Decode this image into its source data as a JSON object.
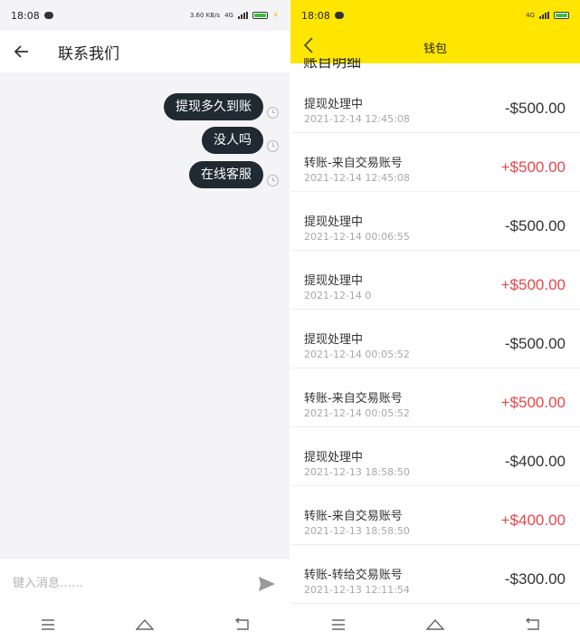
{
  "left": {
    "status": {
      "time": "18:08",
      "network": "3.60 KB/s",
      "signal": "4G"
    },
    "header": {
      "title": "联系我们"
    },
    "messages": [
      {
        "text": "提现多久到账"
      },
      {
        "text": "没人吗"
      },
      {
        "text": "在线客服"
      }
    ],
    "input": {
      "placeholder": "键入消息……"
    }
  },
  "right": {
    "status": {
      "time": "18:08",
      "signal": "4G"
    },
    "header": {
      "title": "钱包"
    },
    "section_title": "账目明细",
    "transactions": [
      {
        "label": "提现处理中",
        "time": "2021-12-14 12:45:08",
        "amount": "-$500.00",
        "sign": "neg"
      },
      {
        "label": "转账-来自交易账号",
        "time": "2021-12-14 12:45:08",
        "amount": "+$500.00",
        "sign": "pos"
      },
      {
        "label": "提现处理中",
        "time": "2021-12-14 00:06:55",
        "amount": "-$500.00",
        "sign": "neg"
      },
      {
        "label": "提现处理中",
        "time": "2021-12-14 0",
        "amount": "+$500.00",
        "sign": "pos"
      },
      {
        "label": "提现处理中",
        "time": "2021-12-14 00:05:52",
        "amount": "-$500.00",
        "sign": "neg"
      },
      {
        "label": "转账-来自交易账号",
        "time": "2021-12-14 00:05:52",
        "amount": "+$500.00",
        "sign": "pos"
      },
      {
        "label": "提现处理中",
        "time": "2021-12-13 18:58:50",
        "amount": "-$400.00",
        "sign": "neg"
      },
      {
        "label": "转账-来自交易账号",
        "time": "2021-12-13 18:58:50",
        "amount": "+$400.00",
        "sign": "pos"
      },
      {
        "label": "转账-转给交易账号",
        "time": "2021-12-13 12:11:54",
        "amount": "-$300.00",
        "sign": "neg"
      }
    ]
  },
  "colors": {
    "accent_yellow": "#ffe600",
    "positive_red": "#e8464a",
    "bubble_dark": "#1f2a33"
  },
  "icons": [
    "back-arrow-icon",
    "clock-icon",
    "send-icon",
    "menu-icon",
    "home-icon",
    "return-icon"
  ]
}
